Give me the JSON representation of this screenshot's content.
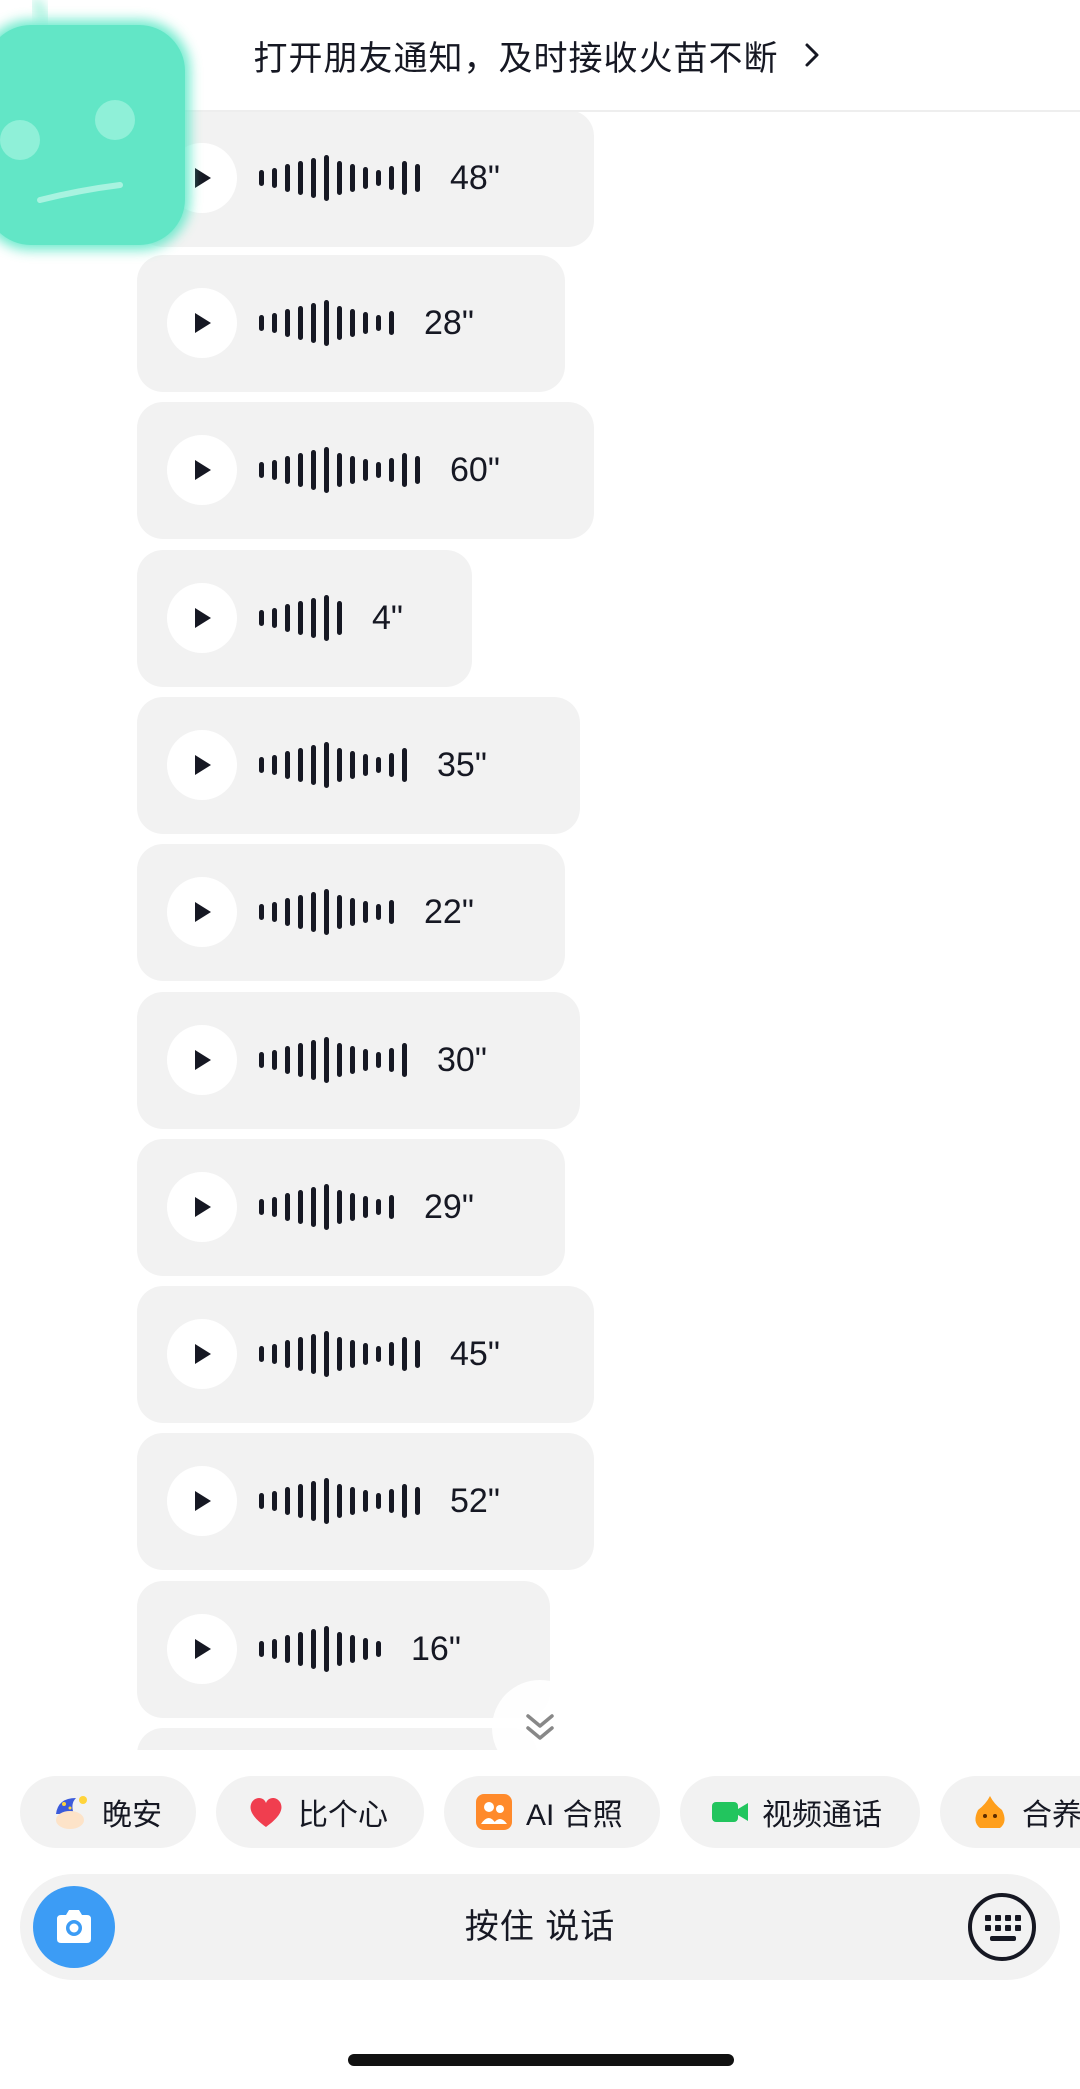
{
  "banner": {
    "text": "打开朋友通知，及时接收火苗不断"
  },
  "voice_messages": [
    {
      "duration": "48\""
    },
    {
      "duration": "28\""
    },
    {
      "duration": "60\""
    },
    {
      "duration": "4\""
    },
    {
      "duration": "35\""
    },
    {
      "duration": "22\""
    },
    {
      "duration": "30\""
    },
    {
      "duration": "29\""
    },
    {
      "duration": "45\""
    },
    {
      "duration": "52\""
    },
    {
      "duration": "16\""
    }
  ],
  "quick_actions": [
    {
      "label": "晚安",
      "icon": "moon-cap-icon"
    },
    {
      "label": "比个心",
      "icon": "heart-icon"
    },
    {
      "label": "AI 合照",
      "icon": "ai-photo-icon"
    },
    {
      "label": "视频通话",
      "icon": "video-camera-icon"
    },
    {
      "label": "合养",
      "icon": "pet-icon"
    }
  ],
  "input_bar": {
    "hold_to_talk": "按住 说话"
  },
  "colors": {
    "accent_blue": "#3c9cf5",
    "bubble_bg": "#f2f2f2",
    "text": "#161823",
    "mascot": "#5ee8c8"
  }
}
